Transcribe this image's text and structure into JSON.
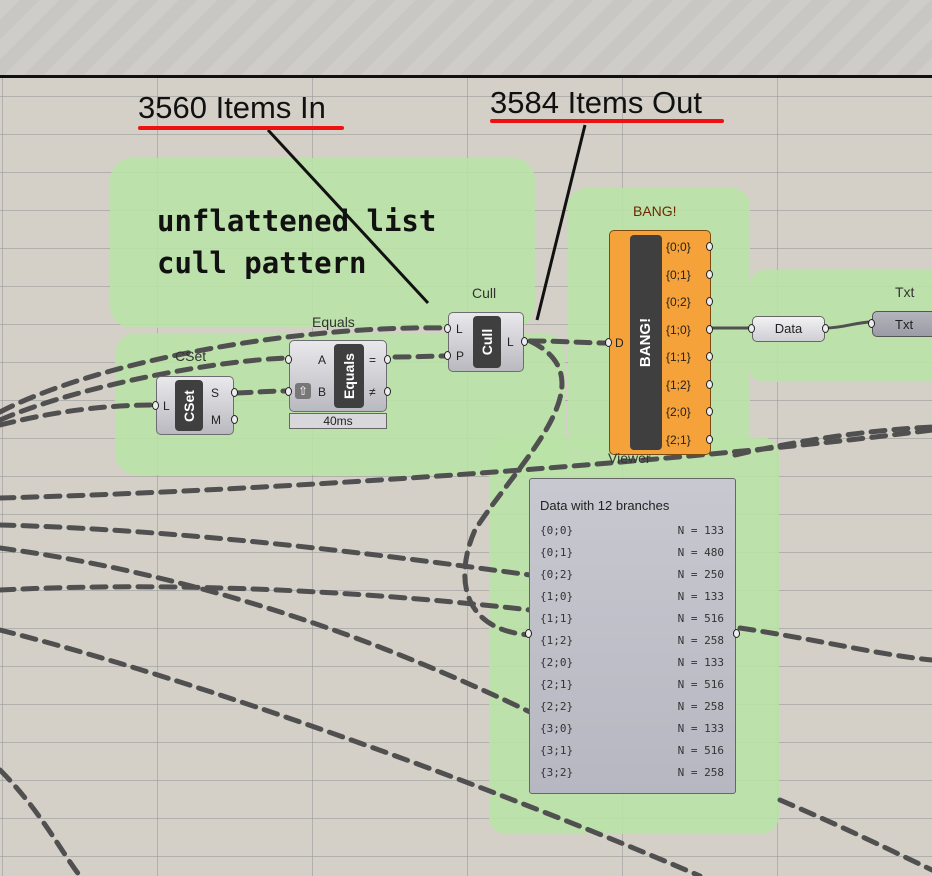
{
  "annotations": {
    "items_in": "3560 Items In",
    "items_out": "3584 Items Out",
    "note": "unflattened list\ncull pattern"
  },
  "components": {
    "cset": {
      "title": "CSet",
      "core": "CSet",
      "in": [
        "L"
      ],
      "out": [
        "S",
        "M"
      ]
    },
    "equals": {
      "title": "Equals",
      "core": "Equals",
      "in": [
        "A",
        "B"
      ],
      "out": [
        "=",
        "≠"
      ],
      "timing": "40ms"
    },
    "cull": {
      "title": "Cull",
      "core": "Cull",
      "in": [
        "L",
        "P"
      ],
      "out": [
        "L"
      ]
    },
    "bang": {
      "title": "BANG!",
      "core": "BANG!",
      "in": [
        "D"
      ],
      "out": [
        "{0;0}",
        "{0;1}",
        "{0;2}",
        "{1;0}",
        "{1;1}",
        "{1;2}",
        "{2;0}",
        "{2;1}"
      ]
    },
    "data": {
      "label": "Data"
    },
    "txt": {
      "title": "Txt",
      "label": "Txt"
    },
    "viewer": {
      "title": "Viewer",
      "header": "Data with 12 branches",
      "rows": [
        {
          "branch": "{0;0}",
          "n": "N = 133"
        },
        {
          "branch": "{0;1}",
          "n": "N = 480"
        },
        {
          "branch": "{0;2}",
          "n": "N = 250"
        },
        {
          "branch": "{1;0}",
          "n": "N = 133"
        },
        {
          "branch": "{1;1}",
          "n": "N = 516"
        },
        {
          "branch": "{1;2}",
          "n": "N = 258"
        },
        {
          "branch": "{2;0}",
          "n": "N = 133"
        },
        {
          "branch": "{2;1}",
          "n": "N = 516"
        },
        {
          "branch": "{2;2}",
          "n": "N = 258"
        },
        {
          "branch": "{3;0}",
          "n": "N = 133"
        },
        {
          "branch": "{3;1}",
          "n": "N = 516"
        },
        {
          "branch": "{3;2}",
          "n": "N = 258"
        }
      ]
    }
  },
  "colors": {
    "group": "#b9e3a6",
    "bang": "#f6a23a",
    "annotation_underline": "#ee1111",
    "wire": "#505050"
  }
}
